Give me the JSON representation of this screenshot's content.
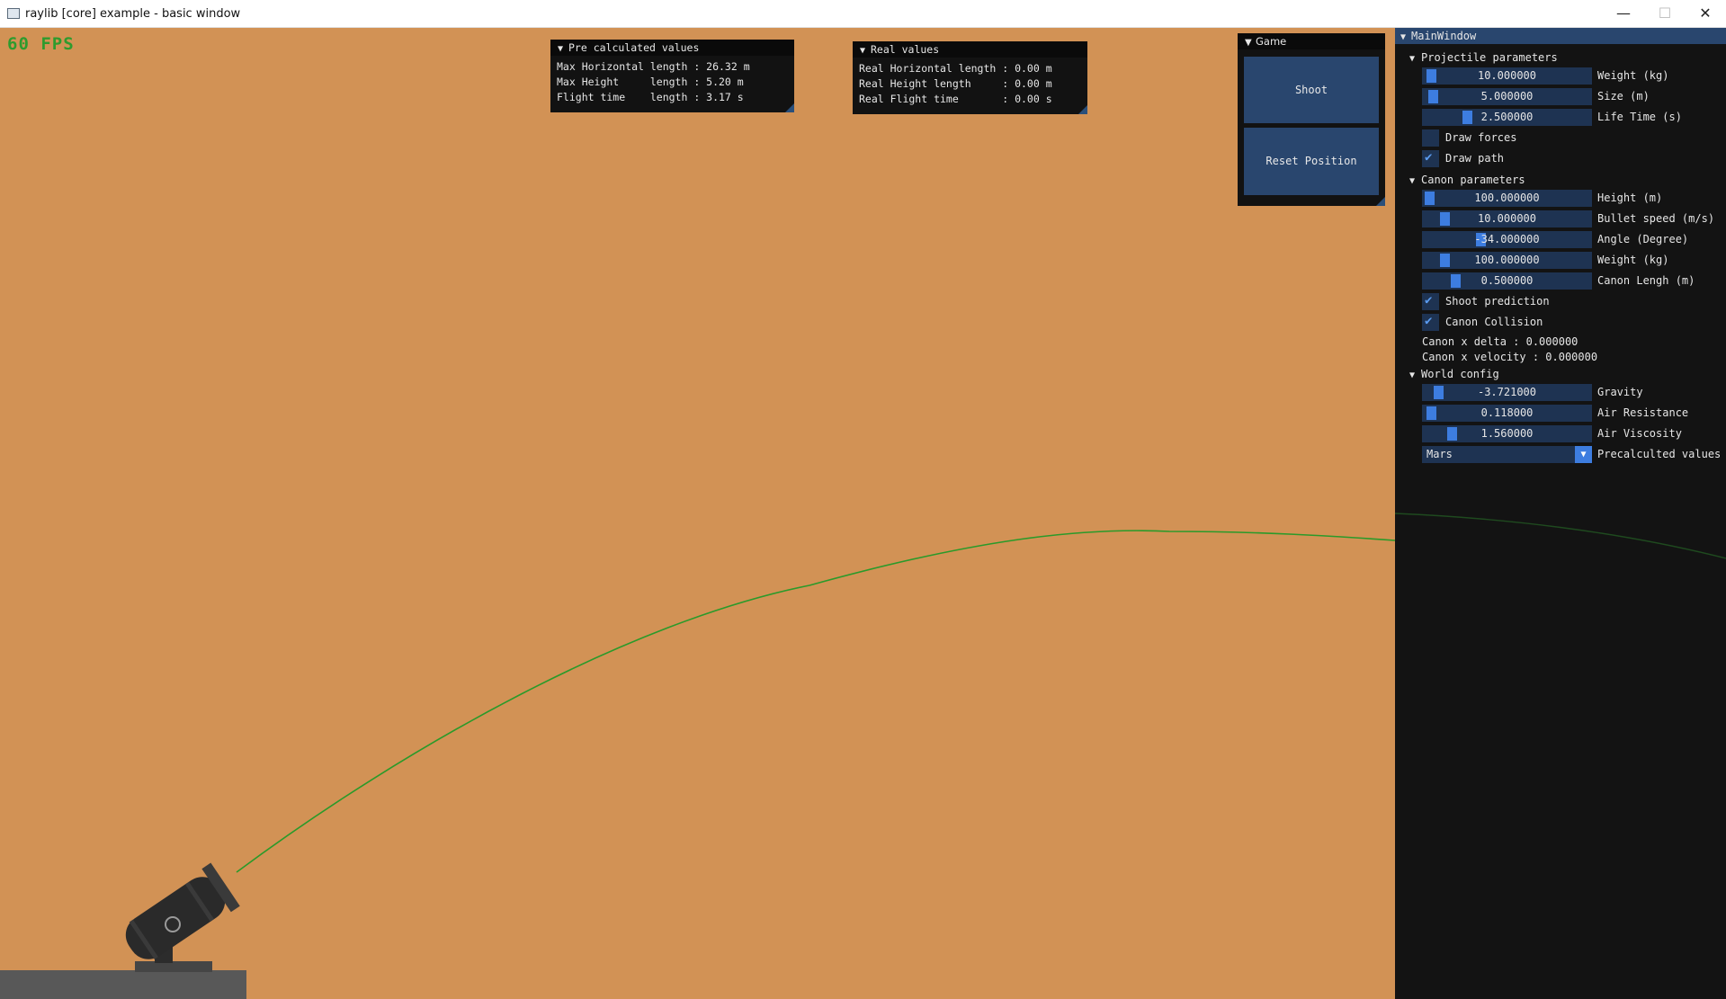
{
  "window": {
    "title": "raylib [core] example - basic window",
    "minimize_glyph": "—",
    "maximize_glyph": "☐",
    "close_glyph": "✕"
  },
  "hud": {
    "fps": "60 FPS"
  },
  "precalc": {
    "title": "Pre calculated values",
    "lines": [
      "Max Horizontal length : 26.32 m",
      "Max Height     length : 5.20 m",
      "Flight time    length : 3.17 s"
    ]
  },
  "real": {
    "title": "Real values",
    "lines": [
      "Real Horizontal length : 0.00 m",
      "Real Height length     : 0.00 m",
      "Real Flight time       : 0.00 s"
    ]
  },
  "game": {
    "title": "Game",
    "shoot_label": "Shoot",
    "reset_label": "Reset Position"
  },
  "main": {
    "title": "MainWindow",
    "projectile": {
      "header": "Projectile parameters",
      "weight": {
        "value": "10.000000",
        "label": "Weight (kg)"
      },
      "size": {
        "value": "5.000000",
        "label": "Size (m)"
      },
      "lifetime": {
        "value": "2.500000",
        "label": "Life Time (s)"
      },
      "draw_forces": {
        "label": "Draw forces",
        "checked": false
      },
      "draw_path": {
        "label": "Draw path",
        "checked": true
      }
    },
    "canon": {
      "header": "Canon parameters",
      "height": {
        "value": "100.000000",
        "label": "Height (m)"
      },
      "bullet_speed": {
        "value": "10.000000",
        "label": "Bullet speed (m/s)"
      },
      "angle": {
        "value": "-34.000000",
        "label": "Angle (Degree)"
      },
      "weight": {
        "value": "100.000000",
        "label": "Weight (kg)"
      },
      "length": {
        "value": "0.500000",
        "label": "Canon Lengh (m)"
      },
      "shoot_prediction": {
        "label": "Shoot prediction",
        "checked": true
      },
      "collision": {
        "label": "Canon Collision",
        "checked": true
      },
      "x_delta": "Canon x delta : 0.000000",
      "x_velocity": "Canon x velocity : 0.000000"
    },
    "world": {
      "header": "World config",
      "gravity": {
        "value": "-3.721000",
        "label": "Gravity"
      },
      "air_resistance": {
        "value": "0.118000",
        "label": "Air Resistance"
      },
      "air_viscosity": {
        "value": "1.560000",
        "label": "Air Viscosity"
      },
      "preset": {
        "value": "Mars",
        "label": "Precalculted values"
      }
    }
  },
  "colors": {
    "background": "#d29255",
    "path": "#2a9a2a",
    "panel": "#131313",
    "accent": "#3d7de0",
    "frame": "#1e3352"
  }
}
